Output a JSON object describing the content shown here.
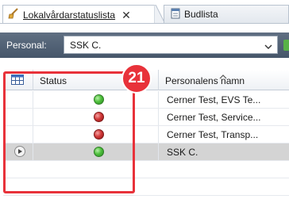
{
  "tabs": [
    {
      "label": "Lokalvårdarstatuslista",
      "icon": "broom-icon",
      "active": true,
      "close_glyph": "✕"
    },
    {
      "label": "Budlista",
      "icon": "document-icon",
      "active": false
    }
  ],
  "filter": {
    "label": "Personal:",
    "value": "SSK C."
  },
  "table": {
    "columns": {
      "status": "Status",
      "name": "Personalens namn"
    },
    "sort": {
      "column": "name",
      "direction": "ascending"
    },
    "rows": [
      {
        "status": "green",
        "name": "Cerner Test, EVS Te...",
        "selected": false
      },
      {
        "status": "red",
        "name": "Cerner Test, Service...",
        "selected": false
      },
      {
        "status": "red",
        "name": "Cerner Test, Transp...",
        "selected": false
      },
      {
        "status": "green",
        "name": "SSK C.",
        "selected": true
      }
    ]
  },
  "annotation": {
    "number": "21"
  },
  "colors": {
    "accent": "#e8323a",
    "status_green": "#4fc03d",
    "status_red": "#d23a3a",
    "bar": "#5f6f82"
  }
}
